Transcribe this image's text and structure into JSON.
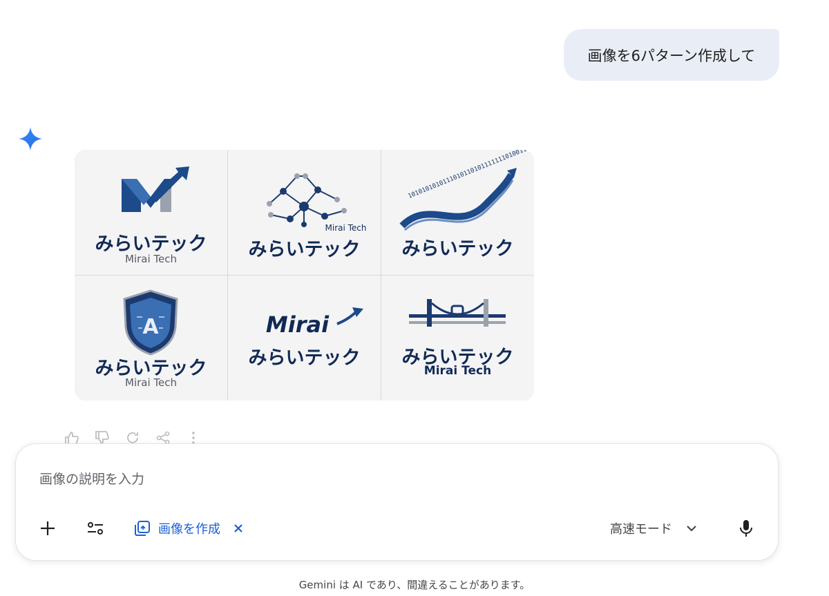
{
  "user_message": "画像を6パターン作成して",
  "assistant_images": [
    {
      "jp": "みらいテック",
      "en": "Mirai Tech"
    },
    {
      "jp": "みらいテック",
      "en": "Mirai Tech"
    },
    {
      "jp": "みらいテック",
      "binary": "1010101010111010110101111111010011"
    },
    {
      "jp": "みらいテック",
      "en": "Mirai Tech"
    },
    {
      "wordmark": "Mirai",
      "jp": "みらいテック"
    },
    {
      "jp": "みらいテック",
      "en": "Mirai Tech"
    }
  ],
  "composer": {
    "placeholder": "画像の説明を入力",
    "create_image_chip": "画像を作成",
    "mode": "高速モード"
  },
  "footer": "Gemini は AI であり、間違えることがあります。",
  "colors": {
    "accent": "#1a5fd6",
    "logo_navy": "#112a55",
    "bubble": "#e9eef6"
  },
  "icons": [
    "sparkle-icon",
    "thumbs-up-icon",
    "thumbs-down-icon",
    "regenerate-icon",
    "share-icon",
    "more-icon",
    "plus-icon",
    "tune-icon",
    "image-create-icon",
    "close-icon",
    "chevron-down-icon",
    "mic-icon"
  ]
}
